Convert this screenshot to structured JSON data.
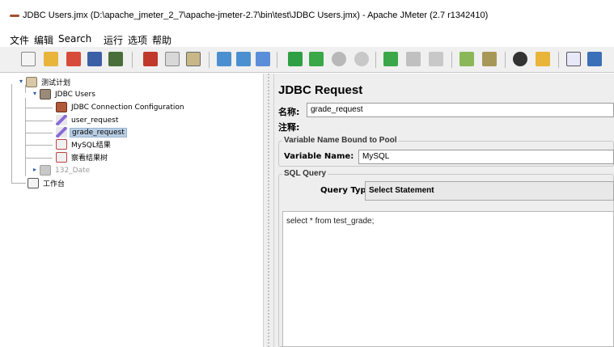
{
  "window": {
    "title": "JDBC Users.jmx (D:\\apache_jmeter_2_7\\apache-jmeter-2.7\\bin\\test\\JDBC Users.jmx) - Apache JMeter (2.7 r1342410)"
  },
  "menu": [
    "文件",
    "编辑",
    "Search",
    "运行",
    "选项",
    "帮助"
  ],
  "toolbar": {
    "buttons": [
      {
        "name": "new-icon",
        "color": "#f4f4f4"
      },
      {
        "name": "open-icon",
        "color": "#e8b43a"
      },
      {
        "name": "open-recent-icon",
        "color": "#d84a3a"
      },
      {
        "name": "save-icon",
        "color": "#3b5fa6"
      },
      {
        "name": "save-as-icon",
        "color": "#4a6e3a"
      },
      {
        "name": "cut-icon",
        "color": "#c0392b"
      },
      {
        "name": "copy-icon",
        "color": "#d8d8d8"
      },
      {
        "name": "paste-icon",
        "color": "#c8b888"
      },
      {
        "name": "expand-icon",
        "color": "#4a90d0"
      },
      {
        "name": "collapse-icon",
        "color": "#4a90d0"
      },
      {
        "name": "toggle-icon",
        "color": "#5a8ed8"
      },
      {
        "name": "start-icon",
        "color": "#2ea043"
      },
      {
        "name": "start-no-pause-icon",
        "color": "#3aa848"
      },
      {
        "name": "stop-icon",
        "color": "#b8b8b8"
      },
      {
        "name": "shutdown-icon",
        "color": "#c8c8c8"
      },
      {
        "name": "remote-start-icon",
        "color": "#3aa848"
      },
      {
        "name": "remote-stop-icon",
        "color": "#c0c0c0"
      },
      {
        "name": "remote-shutdown-icon",
        "color": "#c8c8c8"
      },
      {
        "name": "clear-icon",
        "color": "#8ab858"
      },
      {
        "name": "clear-all-icon",
        "color": "#a89858"
      },
      {
        "name": "search-icon",
        "color": "#333333"
      },
      {
        "name": "reset-search-icon",
        "color": "#e8b43a"
      },
      {
        "name": "function-helper-icon",
        "color": "#e8e8f8"
      },
      {
        "name": "help-icon",
        "color": "#3b6fb8"
      }
    ]
  },
  "tree": {
    "root": "测试计划",
    "thread_group": "JDBC Users",
    "children": [
      "JDBC Connection Configuration",
      "user_request",
      "grade_request",
      "MySQL结果",
      "察看结果树"
    ],
    "disabled_group": "132_Date",
    "workbench": "工作台"
  },
  "detail": {
    "heading": "JDBC Request",
    "name_label": "名称:",
    "name_value": "grade_request",
    "comments_label": "注释:",
    "pool_group_title": "Variable Name Bound to Pool",
    "variable_name_label": "Variable Name:",
    "variable_name_value": "MySQL",
    "sql_group_title": "SQL Query",
    "query_type_label": "Query Type:",
    "query_type_value": "Select Statement",
    "query_text": "select * from test_grade;"
  }
}
